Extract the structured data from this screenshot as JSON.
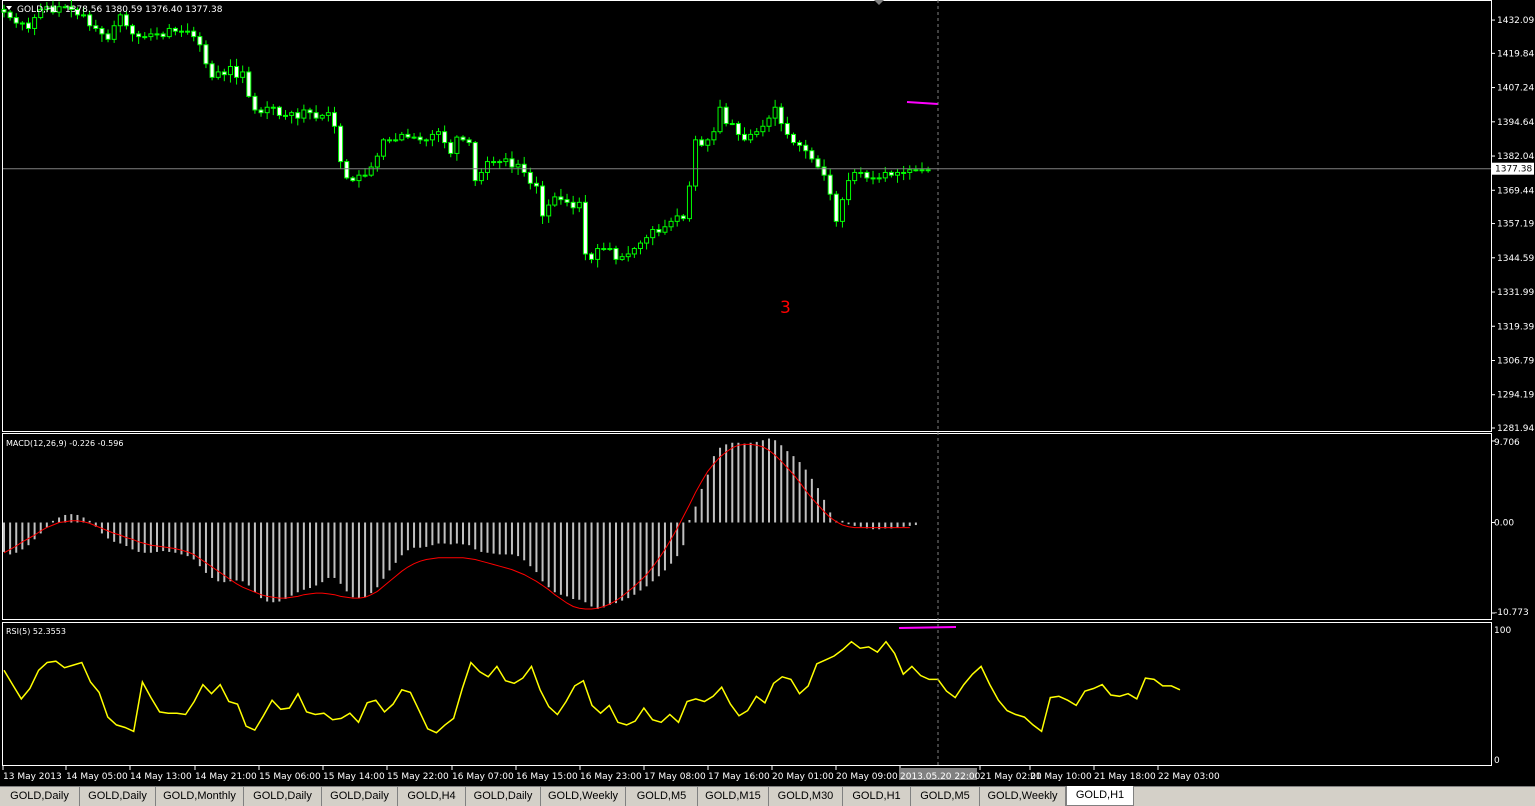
{
  "colors": {
    "background": "#000000",
    "grid": "#ffffff",
    "candle": "#00ff00",
    "candle_body_bull": "#000000",
    "candle_body_bear": "#ffffff",
    "macd_hist": "#c0c0c0",
    "macd_signal": "#ff0000",
    "rsi": "#ffff00",
    "magenta": "#ff00ff",
    "annotation": "#ff0000",
    "text": "#ffffff"
  },
  "header": {
    "symbol": "GOLD,H1",
    "ohlc": "1378.56 1380.59 1376.40 1377.38"
  },
  "annotation": "3",
  "chart_data": [
    {
      "type": "candlestick",
      "title": "GOLD,H1",
      "ylim": [
        1281.94,
        1438.0
      ],
      "yticks": [
        "1432.09",
        "1419.84",
        "1407.24",
        "1394.64",
        "1382.04",
        "1369.44",
        "1357.19",
        "1344.59",
        "1331.99",
        "1319.39",
        "1306.79",
        "1294.19",
        "1281.94"
      ],
      "current_price": "1377.38",
      "close": [
        1435,
        1433,
        1431,
        1431,
        1429,
        1433,
        1436,
        1437,
        1435,
        1437,
        1437,
        1436,
        1434,
        1434,
        1430,
        1429,
        1427,
        1425,
        1430,
        1434,
        1430,
        1427,
        1426,
        1426,
        1427,
        1427,
        1426,
        1429,
        1428,
        1428,
        1428,
        1426,
        1423,
        1416,
        1411,
        1413,
        1412,
        1415,
        1411,
        1413,
        1404,
        1399,
        1398,
        1400,
        1400,
        1397,
        1397,
        1398,
        1396,
        1399,
        1398,
        1396,
        1397,
        1398,
        1393,
        1380,
        1374,
        1373,
        1375,
        1375,
        1378,
        1382,
        1388,
        1388,
        1388,
        1390,
        1389,
        1389,
        1388,
        1388,
        1390,
        1391,
        1387,
        1383,
        1389,
        1388,
        1387,
        1373,
        1376,
        1380,
        1380,
        1380,
        1381,
        1378,
        1379,
        1376,
        1372,
        1371,
        1360,
        1364,
        1367,
        1366,
        1365,
        1363,
        1365,
        1346,
        1344,
        1348,
        1348,
        1348,
        1344,
        1345,
        1346,
        1348,
        1350,
        1352,
        1355,
        1354,
        1356,
        1358,
        1360,
        1359,
        1371,
        1388,
        1386,
        1388,
        1391,
        1400,
        1394,
        1394,
        1390,
        1388,
        1390,
        1391,
        1393,
        1396,
        1400,
        1394,
        1390,
        1387,
        1386,
        1384,
        1381,
        1378,
        1375,
        1368,
        1358,
        1366,
        1373,
        1376,
        1376,
        1374,
        1374,
        1374,
        1376,
        1375,
        1376,
        1376,
        1377,
        1377,
        1377,
        1377
      ],
      "macd": [
        -3.5,
        -3.8,
        -3.6,
        -3.2,
        -2.7,
        -2.0,
        -1.3,
        -0.6,
        0.2,
        0.6,
        0.9,
        1.0,
        0.9,
        0.6,
        0.2,
        -0.5,
        -1.3,
        -1.9,
        -2.3,
        -2.5,
        -2.8,
        -3.2,
        -3.5,
        -3.6,
        -3.6,
        -3.5,
        -3.4,
        -3.5,
        -3.6,
        -3.8,
        -4.0,
        -4.4,
        -5.2,
        -6.0,
        -6.6,
        -7.0,
        -7.1,
        -7.0,
        -6.9,
        -7.0,
        -7.5,
        -8.3,
        -9.0,
        -9.4,
        -9.5,
        -9.4,
        -9.1,
        -8.7,
        -8.3,
        -8.0,
        -7.8,
        -7.5,
        -7.1,
        -6.6,
        -6.6,
        -7.3,
        -8.2,
        -8.9,
        -9.0,
        -8.9,
        -8.4,
        -7.7,
        -6.7,
        -5.7,
        -4.8,
        -3.9,
        -3.3,
        -3.0,
        -3.0,
        -2.9,
        -2.7,
        -2.5,
        -2.5,
        -2.6,
        -2.5,
        -2.6,
        -2.7,
        -3.2,
        -3.5,
        -3.6,
        -3.7,
        -3.8,
        -3.8,
        -3.8,
        -4.0,
        -4.5,
        -5.2,
        -5.9,
        -7.0,
        -7.7,
        -8.3,
        -8.6,
        -8.8,
        -9.1,
        -9.2,
        -9.5,
        -10.0,
        -10.3,
        -10.1,
        -9.8,
        -9.6,
        -9.3,
        -9.0,
        -8.6,
        -8.1,
        -7.6,
        -7.0,
        -6.4,
        -5.7,
        -4.9,
        -4.0,
        -2.7,
        0.3,
        1.9,
        4.0,
        5.7,
        7.9,
        8.9,
        9.3,
        9.5,
        9.5,
        9.4,
        9.5,
        9.6,
        9.8,
        10.0,
        9.8,
        9.2,
        8.5,
        7.9,
        7.2,
        6.3,
        5.2,
        4.1,
        2.7,
        1.2,
        0.2,
        0.2,
        -0.2,
        -0.4,
        -0.5,
        -0.7,
        -0.8,
        -0.8,
        -0.7,
        -0.7,
        -0.6,
        -0.5,
        -0.4,
        -0.3
      ],
      "macd_signal": [
        -3.6,
        -3.2,
        -2.8,
        -2.3,
        -1.9,
        -1.5,
        -1.0,
        -0.6,
        -0.3,
        0.0,
        0.1,
        0.2,
        0.2,
        0.1,
        -0.1,
        -0.4,
        -0.7,
        -1.0,
        -1.3,
        -1.5,
        -1.8,
        -2.0,
        -2.3,
        -2.5,
        -2.7,
        -2.8,
        -2.9,
        -3.0,
        -3.1,
        -3.3,
        -3.5,
        -3.8,
        -4.3,
        -4.8,
        -5.3,
        -5.8,
        -6.3,
        -6.8,
        -7.3,
        -7.7,
        -8.0,
        -8.3,
        -8.6,
        -8.8,
        -8.9,
        -9.0,
        -9.0,
        -8.9,
        -8.8,
        -8.6,
        -8.5,
        -8.4,
        -8.4,
        -8.5,
        -8.6,
        -8.8,
        -8.9,
        -9.0,
        -9.0,
        -8.9,
        -8.6,
        -8.2,
        -7.6,
        -7.0,
        -6.4,
        -5.8,
        -5.3,
        -4.9,
        -4.6,
        -4.4,
        -4.3,
        -4.2,
        -4.2,
        -4.2,
        -4.2,
        -4.2,
        -4.3,
        -4.4,
        -4.6,
        -4.8,
        -5.0,
        -5.2,
        -5.4,
        -5.6,
        -5.9,
        -6.2,
        -6.6,
        -7.0,
        -7.5,
        -8.0,
        -8.6,
        -9.1,
        -9.6,
        -10.0,
        -10.2,
        -10.3,
        -10.3,
        -10.2,
        -10.0,
        -9.7,
        -9.3,
        -8.8,
        -8.2,
        -7.6,
        -6.9,
        -6.2,
        -5.3,
        -4.3,
        -3.2,
        -2.0,
        -0.7,
        0.7,
        2.1,
        3.6,
        4.9,
        6.1,
        7.0,
        7.8,
        8.4,
        8.9,
        9.2,
        9.3,
        9.3,
        9.2,
        9.0,
        8.6,
        8.0,
        7.3,
        6.5,
        5.7,
        4.8,
        3.8,
        2.9,
        2.1,
        1.3,
        0.6,
        0.1,
        -0.3,
        -0.5,
        -0.6,
        -0.6,
        -0.6,
        -0.6,
        -0.6,
        -0.6,
        -0.6,
        -0.6,
        -0.6,
        -0.6
      ],
      "macd_ylim": [
        -10.773,
        9.706
      ],
      "macd_yticks": [
        "9.706",
        "0.00",
        "-10.773"
      ],
      "macd_label": "MACD(12,26,9) -0.226 -0.596",
      "rsi": [
        69,
        58,
        47,
        55,
        69,
        75,
        76,
        71,
        73,
        75,
        60,
        52,
        33,
        27,
        25,
        22,
        60,
        48,
        37,
        36,
        36,
        35,
        45,
        58,
        51,
        58,
        45,
        43,
        26,
        23,
        34,
        46,
        39,
        40,
        51,
        37,
        35,
        36,
        31,
        32,
        36,
        29,
        44,
        46,
        37,
        43,
        54,
        52,
        38,
        24,
        21,
        27,
        32,
        55,
        75,
        68,
        64,
        72,
        61,
        59,
        63,
        72,
        54,
        41,
        35,
        45,
        57,
        61,
        42,
        36,
        42,
        29,
        27,
        30,
        40,
        31,
        29,
        35,
        29,
        45,
        47,
        45,
        49,
        56,
        43,
        34,
        38,
        49,
        44,
        59,
        64,
        62,
        51,
        57,
        74,
        77,
        80,
        85,
        91,
        86,
        87,
        83,
        91,
        82,
        66,
        72,
        65,
        62,
        62,
        53,
        48,
        58,
        66,
        72,
        58,
        46,
        38,
        35,
        33,
        27,
        22,
        48,
        49,
        46,
        42,
        53,
        55,
        58,
        50,
        49,
        51,
        47,
        63,
        62,
        57,
        57,
        54
      ],
      "rsi_ylim": [
        0,
        100
      ],
      "rsi_yticks": [
        "100",
        "0"
      ],
      "rsi_label": "RSI(5) 52.3553",
      "xlabels": [
        "13 May 2013",
        "14 May 05:00",
        "14 May 13:00",
        "14 May 21:00",
        "15 May 06:00",
        "15 May 14:00",
        "15 May 22:00",
        "16 May 07:00",
        "16 May 15:00",
        "16 May 23:00",
        "17 May 08:00",
        "17 May 16:00",
        "20 May 01:00",
        "20 May 09:00",
        "2013.05.20 22:00",
        "21 May 02:00",
        "21 May 10:00",
        "21 May 18:00",
        "22 May 03:00"
      ]
    }
  ],
  "tabs": [
    "GOLD,Daily",
    "GOLD,Daily",
    "GOLD,Monthly",
    "GOLD,Daily",
    "GOLD,Daily",
    "GOLD,H4",
    "GOLD,Daily",
    "GOLD,Weekly",
    "GOLD,M5",
    "GOLD,M15",
    "GOLD,M30",
    "GOLD,H1",
    "GOLD,M5",
    "GOLD,Weekly",
    "GOLD,H1"
  ]
}
